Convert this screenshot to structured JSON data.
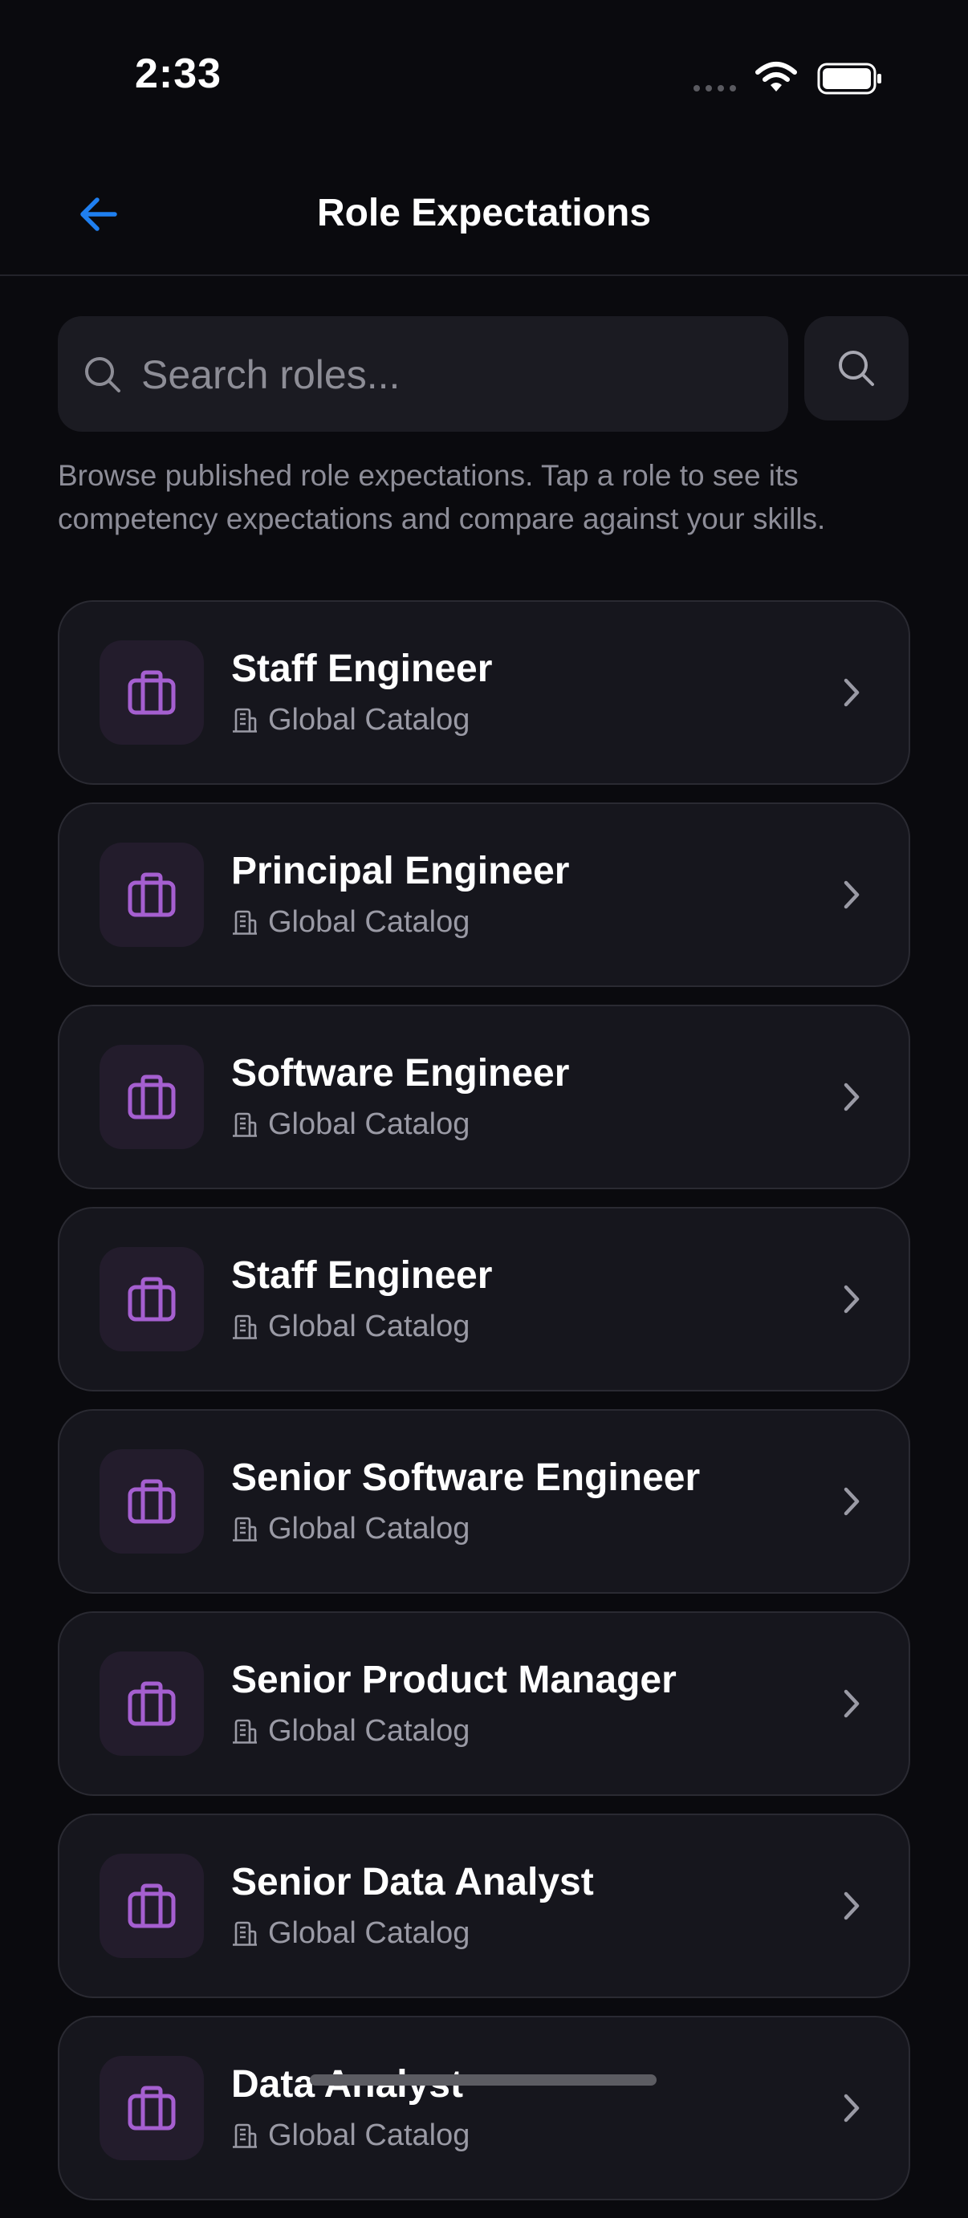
{
  "status_bar": {
    "time": "2:33"
  },
  "header": {
    "title": "Role Expectations"
  },
  "search": {
    "placeholder": "Search roles..."
  },
  "description": "Browse published role expectations. Tap a role to see its competency expectations and compare against your skills.",
  "roles": [
    {
      "title": "Staff Engineer",
      "source": "Global Catalog"
    },
    {
      "title": "Principal Engineer",
      "source": "Global Catalog"
    },
    {
      "title": "Software Engineer",
      "source": "Global Catalog"
    },
    {
      "title": "Staff Engineer",
      "source": "Global Catalog"
    },
    {
      "title": "Senior Software Engineer",
      "source": "Global Catalog"
    },
    {
      "title": "Senior Product Manager",
      "source": "Global Catalog"
    },
    {
      "title": "Senior Data Analyst",
      "source": "Global Catalog"
    },
    {
      "title": "Data Analyst",
      "source": "Global Catalog"
    }
  ],
  "colors": {
    "background": "#0a0a0e",
    "card": "#16161d",
    "accent_blue": "#1f7ff0",
    "icon_purple": "#a55fd0",
    "muted_text": "#8d8d98"
  },
  "icons": {
    "back": "arrow-left-icon",
    "search": "magnifier-icon",
    "role": "briefcase-icon",
    "source": "building-icon",
    "row_action": "chevron-right-icon"
  }
}
